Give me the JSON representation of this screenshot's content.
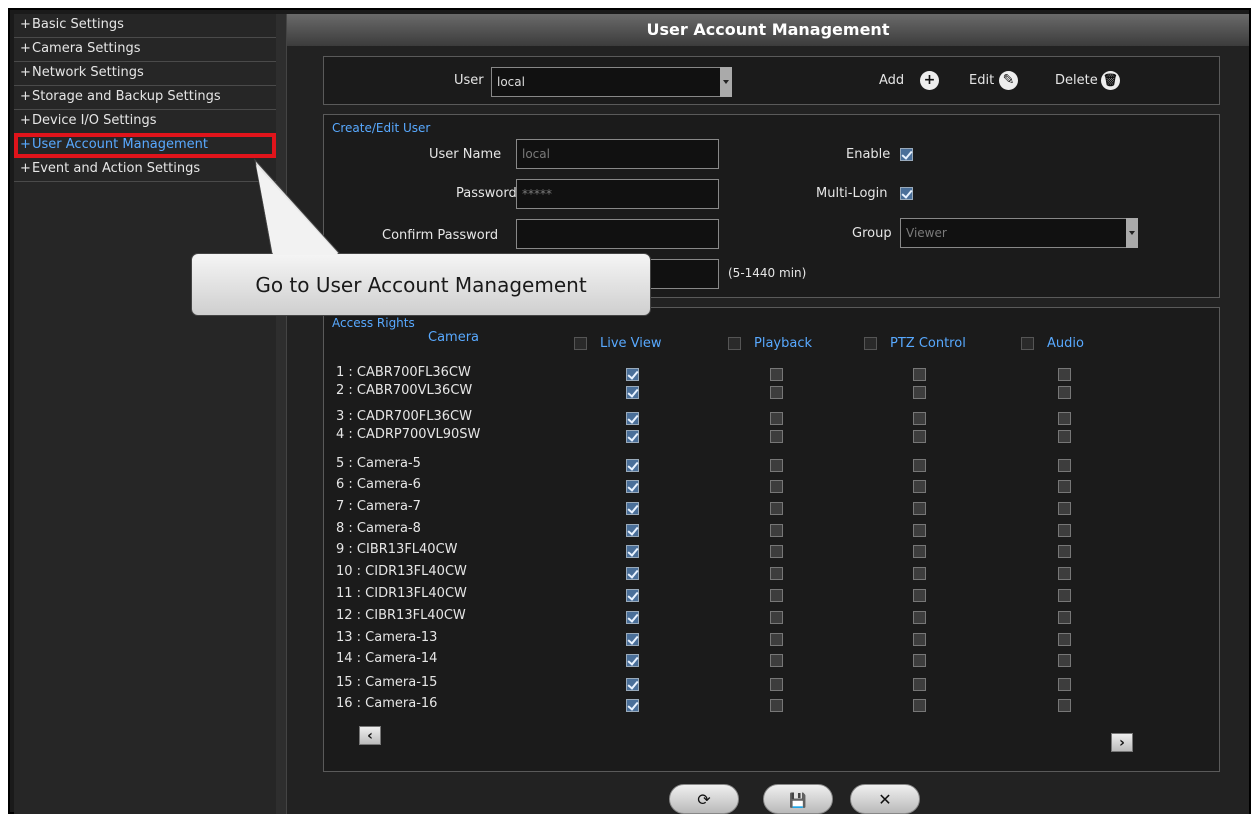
{
  "sidebar": {
    "items": [
      {
        "prefix": "+",
        "label": "Basic Settings"
      },
      {
        "prefix": "+",
        "label": "Camera Settings"
      },
      {
        "prefix": "+",
        "label": "Network Settings"
      },
      {
        "prefix": "+",
        "label": "Storage and Backup Settings"
      },
      {
        "prefix": "+",
        "label": "Device I/O Settings"
      },
      {
        "prefix": "+",
        "label": "User Account Management",
        "selected": true
      },
      {
        "prefix": "+",
        "label": "Event and Action Settings"
      }
    ]
  },
  "header": {
    "title": "User Account Management"
  },
  "user_bar": {
    "user_label": "User",
    "user_value": "local",
    "add_label": "Add",
    "edit_label": "Edit",
    "delete_label": "Delete"
  },
  "create_edit": {
    "section_title": "Create/Edit User",
    "user_name_label": "User Name",
    "user_name_value": "local",
    "password_label": "Password",
    "password_value": "*****",
    "confirm_password_label": "Confirm Password",
    "confirm_password_value": "",
    "timeout_value": "",
    "timeout_hint": "(5-1440 min)",
    "enable_label": "Enable",
    "enable_checked": true,
    "multilogin_label": "Multi-Login",
    "multilogin_checked": true,
    "group_label": "Group",
    "group_value": "Viewer"
  },
  "access_rights": {
    "section_title": "Access Rights",
    "camera_header": "Camera",
    "columns": [
      "Live View",
      "Playback",
      "PTZ Control",
      "Audio"
    ],
    "cameras": [
      {
        "name": "1 : CABR700FL36CW",
        "rights": [
          true,
          false,
          false,
          false
        ]
      },
      {
        "name": "2 : CABR700VL36CW",
        "rights": [
          true,
          false,
          false,
          false
        ]
      },
      {
        "name": "3 : CADR700FL36CW",
        "rights": [
          true,
          false,
          false,
          false
        ]
      },
      {
        "name": "4 : CADRP700VL90SW",
        "rights": [
          true,
          false,
          false,
          false
        ]
      },
      {
        "name": "5 : Camera-5",
        "rights": [
          true,
          false,
          false,
          false
        ]
      },
      {
        "name": "6 : Camera-6",
        "rights": [
          true,
          false,
          false,
          false
        ]
      },
      {
        "name": "7 : Camera-7",
        "rights": [
          true,
          false,
          false,
          false
        ]
      },
      {
        "name": "8 : Camera-8",
        "rights": [
          true,
          false,
          false,
          false
        ]
      },
      {
        "name": "9 : CIBR13FL40CW",
        "rights": [
          true,
          false,
          false,
          false
        ]
      },
      {
        "name": "10 : CIDR13FL40CW",
        "rights": [
          true,
          false,
          false,
          false
        ]
      },
      {
        "name": "11 : CIDR13FL40CW",
        "rights": [
          true,
          false,
          false,
          false
        ]
      },
      {
        "name": "12 : CIBR13FL40CW",
        "rights": [
          true,
          false,
          false,
          false
        ]
      },
      {
        "name": "13 : Camera-13",
        "rights": [
          true,
          false,
          false,
          false
        ]
      },
      {
        "name": "14 : Camera-14",
        "rights": [
          true,
          false,
          false,
          false
        ]
      },
      {
        "name": "15 : Camera-15",
        "rights": [
          true,
          false,
          false,
          false
        ]
      },
      {
        "name": "16 : Camera-16",
        "rights": [
          true,
          false,
          false,
          false
        ]
      }
    ]
  },
  "footer": {
    "refresh_icon": "⟳",
    "save_icon": "💾",
    "close_icon": "✕"
  },
  "callout": {
    "text": "Go to User Account Management"
  },
  "colors": {
    "accent_blue": "#58a9ff",
    "highlight_red": "#e0141b"
  }
}
